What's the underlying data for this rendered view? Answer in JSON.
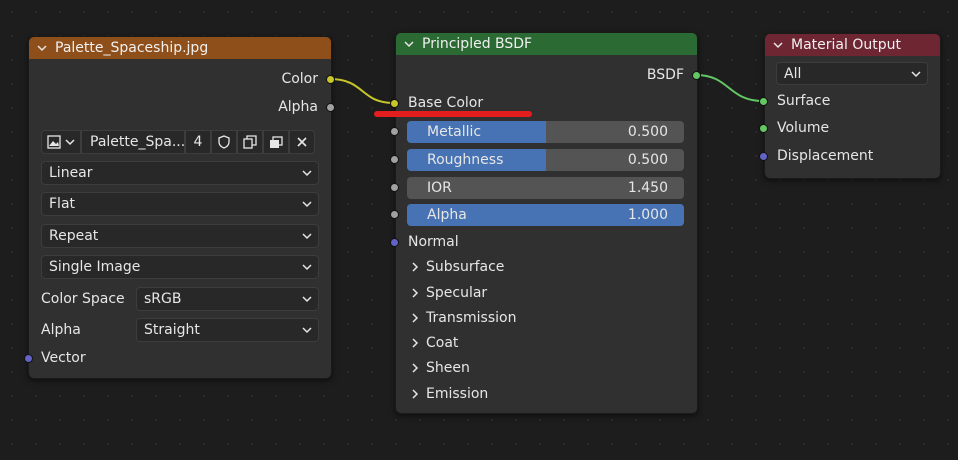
{
  "image_node": {
    "title": "Palette_Spaceship.jpg",
    "header_color": "#8f4f1a",
    "outputs": [
      "Color",
      "Alpha"
    ],
    "image_name": "Palette_Spa...",
    "users_count": "4",
    "interpolation": "Linear",
    "projection": "Flat",
    "extension": "Repeat",
    "source": "Single Image",
    "color_space_label": "Color Space",
    "color_space_value": "sRGB",
    "alpha_label": "Alpha",
    "alpha_value": "Straight",
    "input": "Vector"
  },
  "bsdf_node": {
    "title": "Principled BSDF",
    "header_color": "#2b6a33",
    "output": "BSDF",
    "base_color_label": "Base Color",
    "sliders": [
      {
        "label": "Metallic",
        "value": "0.500",
        "fraction": 0.5
      },
      {
        "label": "Roughness",
        "value": "0.500",
        "fraction": 0.5
      },
      {
        "label": "IOR",
        "value": "1.450",
        "fraction": 0
      },
      {
        "label": "Alpha",
        "value": "1.000",
        "fraction": 1.0
      }
    ],
    "normal_label": "Normal",
    "panels": [
      "Subsurface",
      "Specular",
      "Transmission",
      "Coat",
      "Sheen",
      "Emission"
    ]
  },
  "output_node": {
    "title": "Material Output",
    "header_color": "#6e2633",
    "target": "All",
    "inputs": [
      "Surface",
      "Volume",
      "Displacement"
    ]
  },
  "colors": {
    "link_yellow": "#c7c729",
    "link_green": "#63c763",
    "annotation_red": "#e41e1e",
    "slider_blue": "#4772b3"
  }
}
